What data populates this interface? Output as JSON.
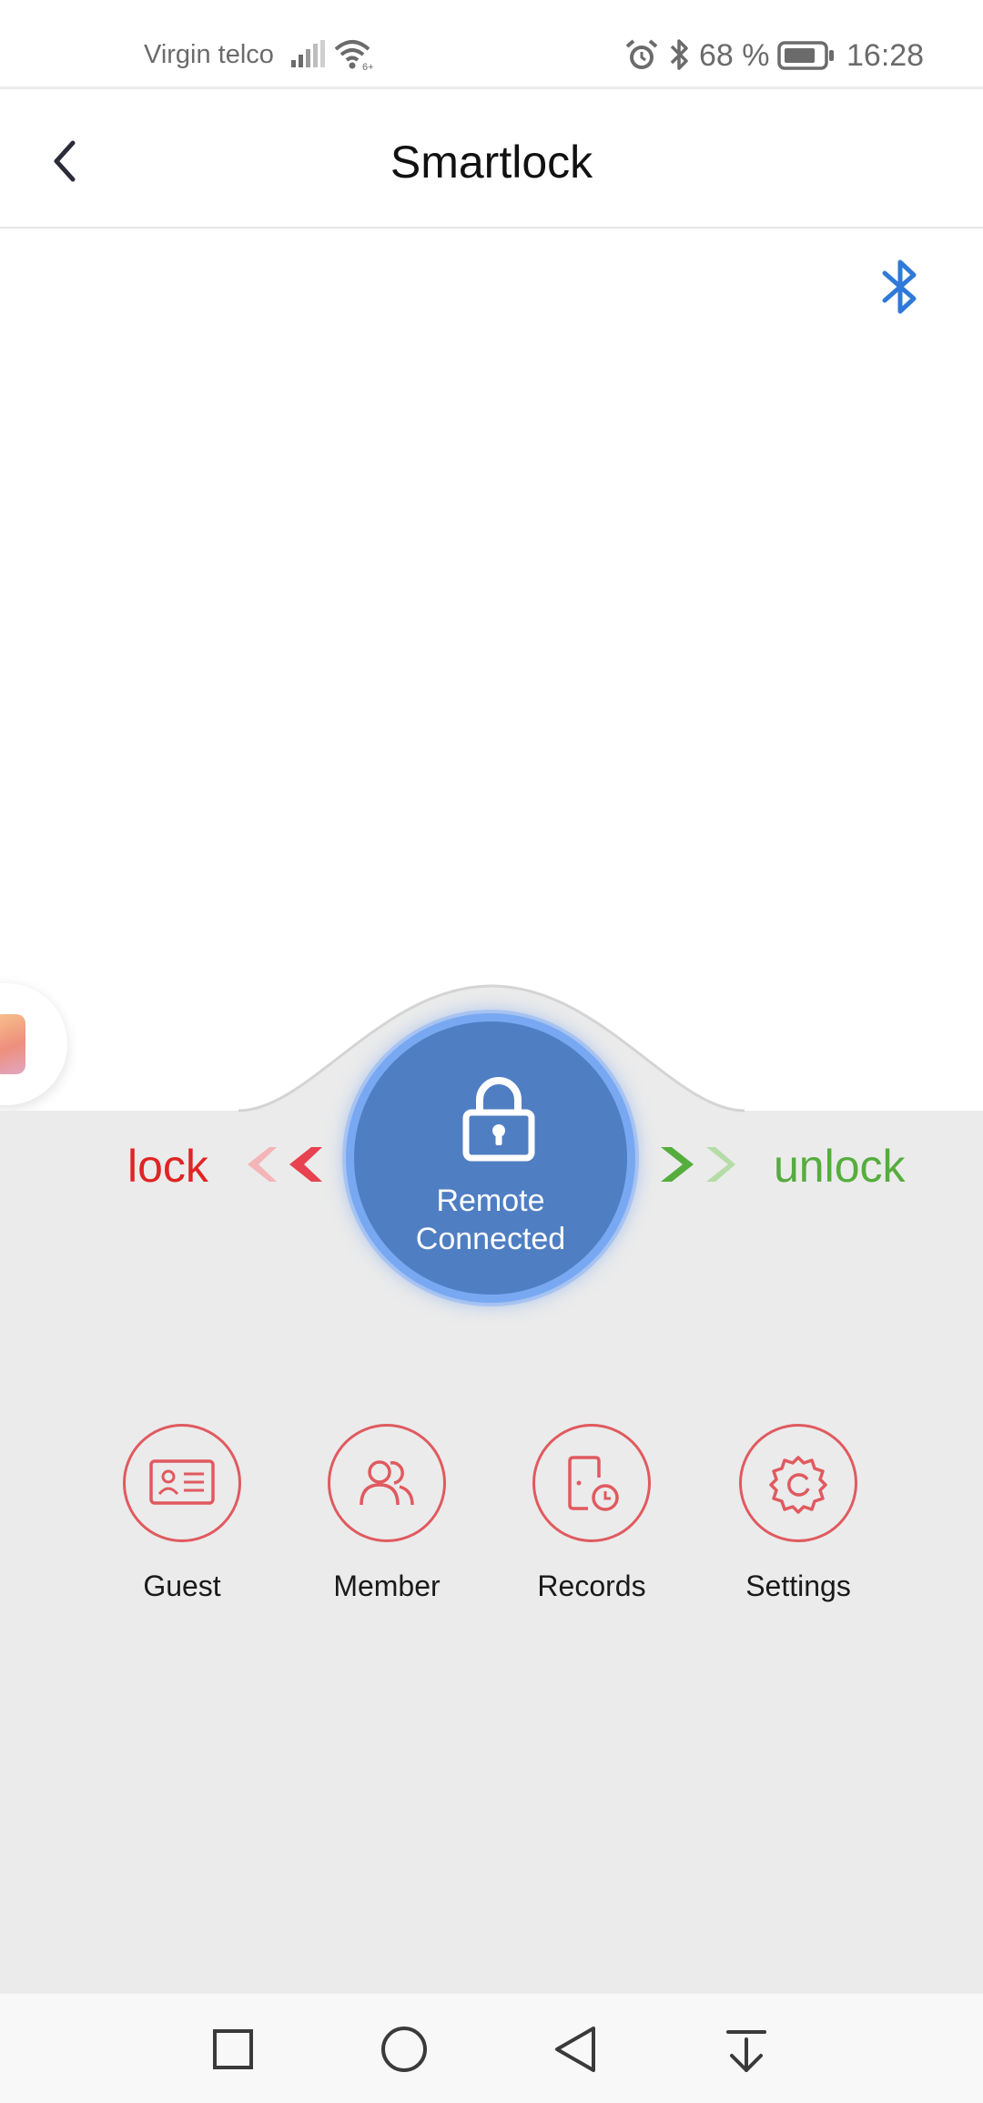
{
  "status_bar": {
    "carrier": "Virgin telco",
    "battery_percent": "68 %",
    "time": "16:28",
    "icons": [
      "signal-icon",
      "wifi-icon",
      "alarm-icon",
      "bluetooth-icon",
      "battery-icon"
    ]
  },
  "header": {
    "title": "Smartlock",
    "back_icon": "chevron-left-icon"
  },
  "lock_control": {
    "lock_label": "lock",
    "unlock_label": "unlock",
    "button_line1": "Remote",
    "button_line2": "Connected",
    "icon": "padlock-icon"
  },
  "actions": [
    {
      "label": "Guest",
      "icon": "id-card-icon"
    },
    {
      "label": "Member",
      "icon": "users-icon"
    },
    {
      "label": "Records",
      "icon": "door-clock-icon"
    },
    {
      "label": "Settings",
      "icon": "gear-icon"
    }
  ],
  "colors": {
    "accent_blue": "#4f7ec2",
    "lock_red": "#e02424",
    "unlock_green": "#55ad3d",
    "action_red": "#e05a5f",
    "panel_gray": "#ebebeb",
    "bluetooth_blue": "#2f7ad8"
  },
  "nav_bar": {
    "icons": [
      "square-recent-icon",
      "circle-home-icon",
      "triangle-back-icon",
      "notification-down-icon"
    ]
  }
}
